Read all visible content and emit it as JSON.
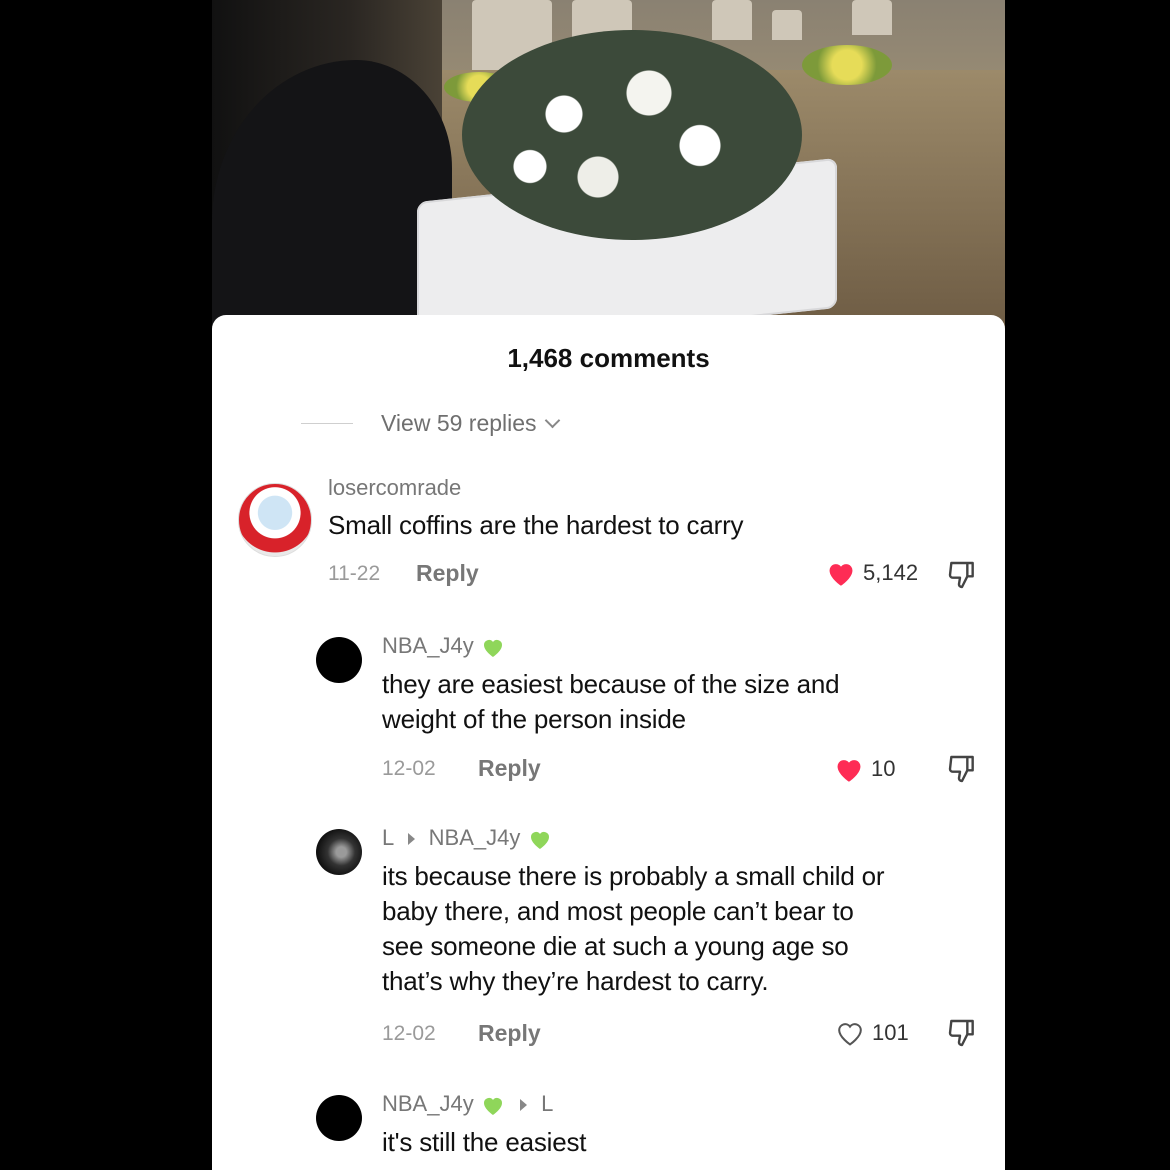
{
  "comments_count": "1,468 comments",
  "view_replies": "View 59 replies",
  "comments": [
    {
      "username": "losercomrade",
      "text": "Small coffins are the hardest to carry",
      "date": "11-22",
      "reply_label": "Reply",
      "likes": "5,142",
      "liked": true
    },
    {
      "username": "NBA_J4y",
      "text_lines": [
        "they are easiest because of the size and",
        "weight of the person inside"
      ],
      "date": "12-02",
      "reply_label": "Reply",
      "likes": "10",
      "liked": true
    },
    {
      "username_prefix": "L",
      "reply_to": "NBA_J4y",
      "text_lines": [
        "its because there is probably a small child or",
        "baby there, and most people can’t bear to",
        "see someone die at such a young age so",
        "that’s why they’re hardest to carry."
      ],
      "date": "12-02",
      "reply_label": "Reply",
      "likes": "101",
      "liked": false
    },
    {
      "username": "NBA_J4y",
      "reply_to": "L",
      "text": "it's still the easiest"
    }
  ],
  "colors": {
    "like_red": "#fe2c55",
    "green_heart": "#8fd65a"
  },
  "icons": [
    "heart-icon",
    "dislike-icon",
    "green-heart-icon",
    "chevron-down-icon"
  ]
}
